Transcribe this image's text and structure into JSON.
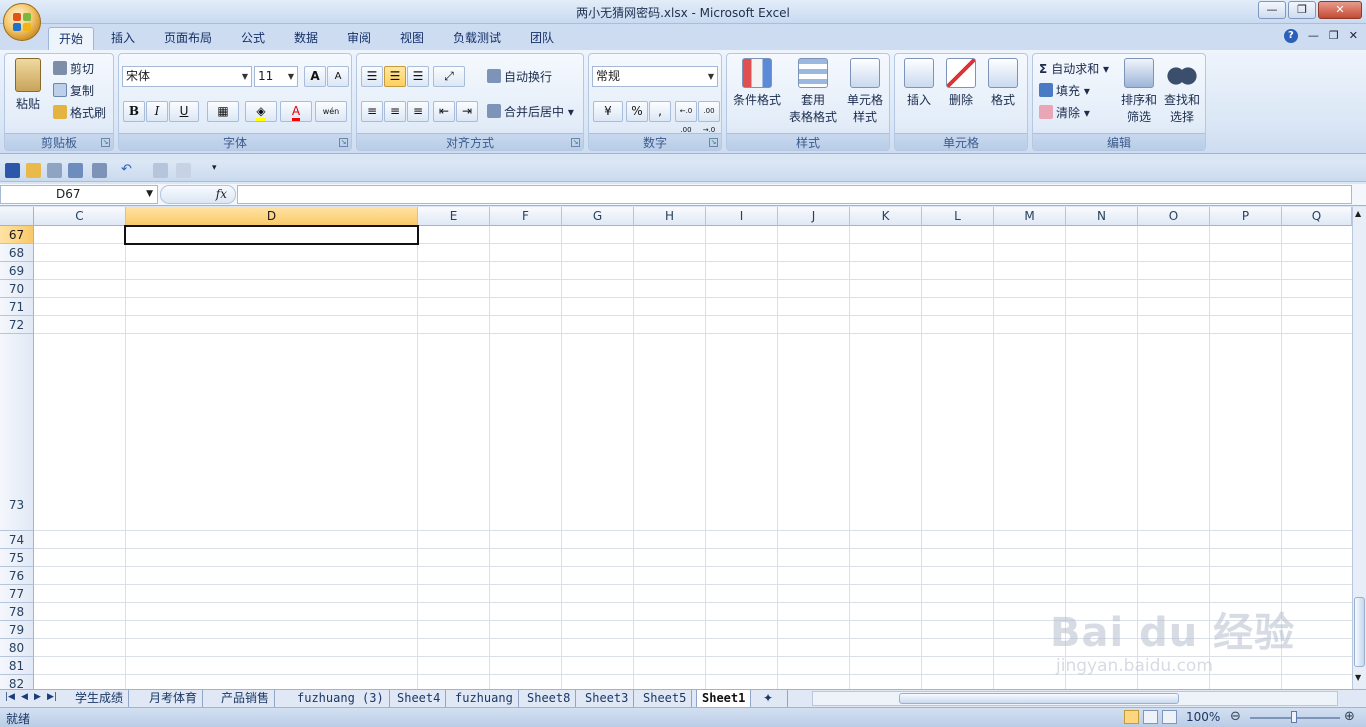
{
  "window": {
    "title": "两小无猜网密码.xlsx - Microsoft Excel",
    "controls": {
      "minimize": "—",
      "restore": "❐",
      "close": "✕"
    }
  },
  "ribbon_tabs": [
    "开始",
    "插入",
    "页面布局",
    "公式",
    "数据",
    "审阅",
    "视图",
    "负载测试",
    "团队"
  ],
  "ribbon_tab_active": "开始",
  "ribbon_right": {
    "help": "?",
    "minimize": "—",
    "restore": "❐",
    "close": "✕"
  },
  "ribbon": {
    "clipboard": {
      "label": "剪贴板",
      "paste": "粘贴",
      "cut": "剪切",
      "copy": "复制",
      "format_painter": "格式刷"
    },
    "font": {
      "label": "字体",
      "font_name": "宋体",
      "font_size": "11",
      "grow": "A",
      "shrink": "A",
      "bold": "B",
      "italic": "I",
      "underline": "U",
      "font_color_letter": "A",
      "phonetic": "wén"
    },
    "alignment": {
      "label": "对齐方式",
      "wrap": "自动换行",
      "merge": "合并后居中"
    },
    "number": {
      "label": "数字",
      "format": "常规",
      "percent": "%",
      "comma": ",",
      "inc_decimal": "←.0 .00",
      "dec_decimal": ".00 →.0"
    },
    "styles": {
      "label": "样式",
      "conditional": "条件格式",
      "table_1": "套用",
      "table_2": "表格格式",
      "cell_styles_1": "单元格",
      "cell_styles_2": "样式"
    },
    "cells": {
      "label": "单元格",
      "insert": "插入",
      "delete": "删除",
      "format": "格式"
    },
    "editing": {
      "label": "编辑",
      "autosum": "自动求和",
      "fill": "填充",
      "clear": "清除",
      "sort_1": "排序和",
      "sort_2": "筛选",
      "find_1": "查找和",
      "find_2": "选择"
    }
  },
  "formula_bar": {
    "name_box": "D67",
    "fx": "fx",
    "formula": ""
  },
  "grid": {
    "columns": [
      "C",
      "D",
      "E",
      "F",
      "G",
      "H",
      "I",
      "J",
      "K",
      "L",
      "M",
      "N",
      "O",
      "P",
      "Q"
    ],
    "selected_column": "D",
    "rows": [
      "67",
      "68",
      "69",
      "70",
      "71",
      "72",
      "73",
      "74",
      "75",
      "76",
      "77",
      "78",
      "79",
      "80",
      "81",
      "82"
    ],
    "selected_row": "67",
    "selected_cell": "D67"
  },
  "sheet_tabs": [
    "学生成绩",
    "月考体育",
    "产品销售",
    "fuzhuang (3)",
    "Sheet4",
    "fuzhuang",
    "Sheet8",
    "Sheet3",
    "Sheet5",
    "Sheet1"
  ],
  "active_sheet": "Sheet1",
  "status_bar": {
    "ready": "就绪",
    "zoom": "100%"
  },
  "watermark": {
    "line1": "Bai du 经验",
    "line2": "jingyan.baidu.com"
  },
  "colors": {
    "accent": "#f9c969",
    "ribbon": "#dbe7f6",
    "grid_line": "#dadfe8"
  }
}
